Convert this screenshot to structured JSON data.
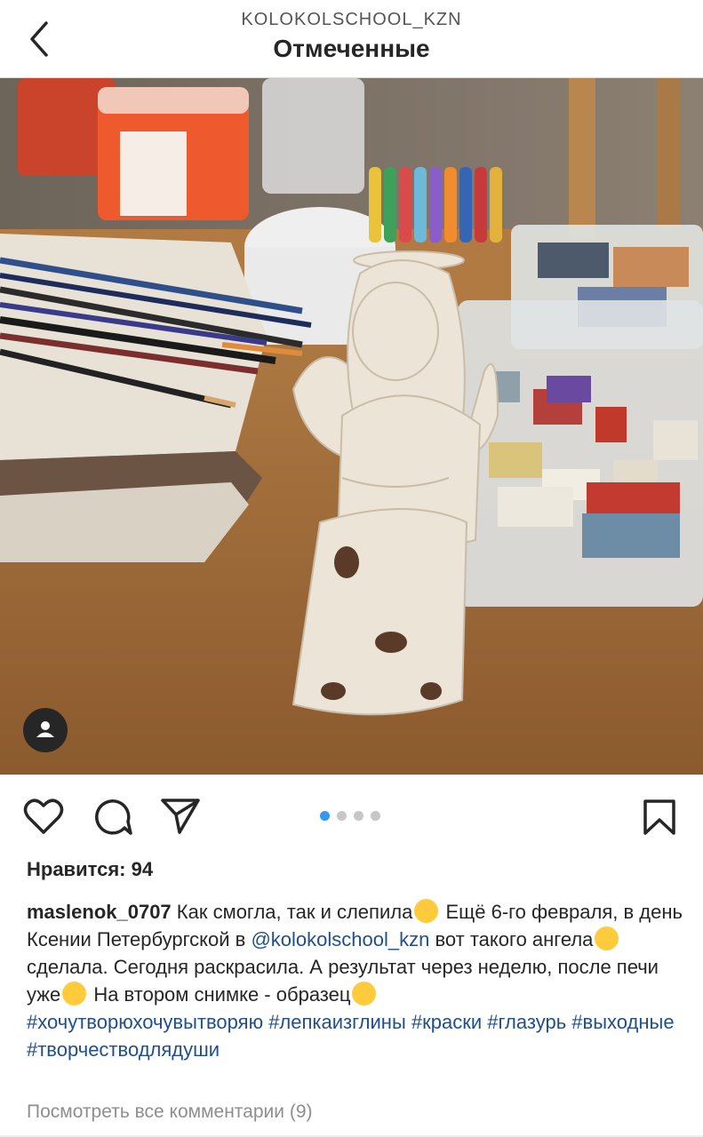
{
  "header": {
    "subtitle": "KOLOKOLSCHOOL_KZN",
    "title": "Отмеченные",
    "back_icon": "chevron-left-icon"
  },
  "post": {
    "carousel": {
      "count": 4,
      "active_index": 0
    },
    "likes_label": "Нравится: 94",
    "caption": {
      "username": "maslenok_0707",
      "text1": " Как смогла, так и слепила",
      "text2": " Ещё 6-го февраля, в день Ксении Петербургской в ",
      "mention": "@kolokolschool_kzn",
      "text3": " вот такого ангела",
      "text4": " сделала. Сегодня раскрасила. А результат через неделю, после печи уже",
      "text5": "  На втором снимке - образец",
      "hashtags": [
        "#хочутворюхочувытворяю",
        "#лепкаизглины",
        "#краски",
        "#глазурь",
        "#выходные",
        "#творчестводлядуши"
      ]
    },
    "view_comments_label": "Посмотреть все комментарии (9)"
  },
  "icons": {
    "like": "heart-icon",
    "comment": "comment-icon",
    "share": "paper-plane-icon",
    "save": "bookmark-icon",
    "tagged_user": "user-icon"
  },
  "colors": {
    "link": "#1f4f8c",
    "carousel_active": "#3897f0",
    "carousel_inactive": "#c7c7c7"
  }
}
